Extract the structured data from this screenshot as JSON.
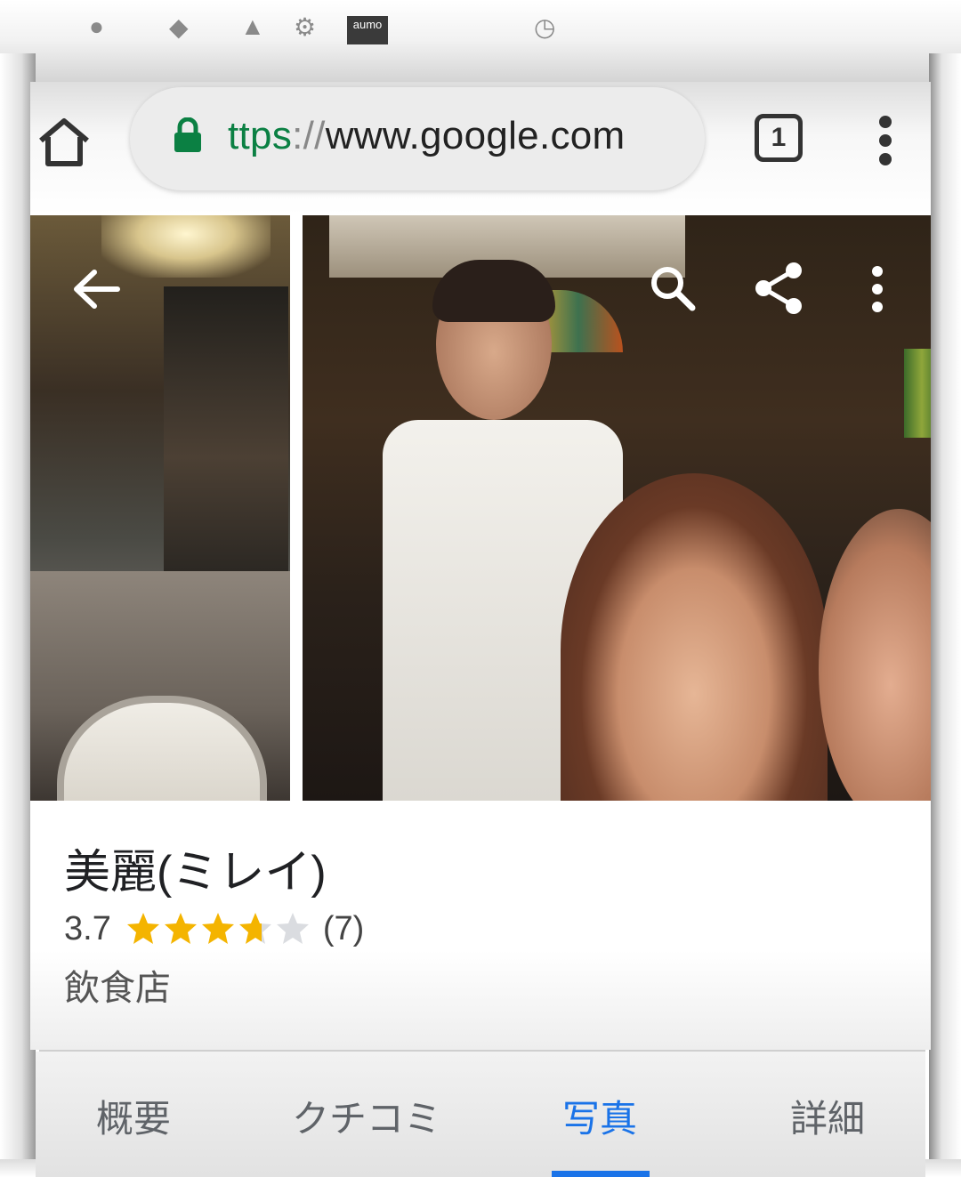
{
  "status_bar": {
    "carrier_badge": "aumo"
  },
  "browser": {
    "url_scheme": "ttps",
    "url_separator": "://",
    "url_host": "www.google.com",
    "tab_count": "1",
    "icons": [
      "home-icon",
      "lock-icon",
      "tab-switcher-icon",
      "more-vert-icon"
    ]
  },
  "photos": {
    "icons": [
      "back-arrow-icon",
      "search-icon",
      "share-icon",
      "more-vert-icon"
    ]
  },
  "place": {
    "name": "美麗(ミレイ)",
    "rating": "3.7",
    "rating_value": 3.7,
    "review_count": "(7)",
    "category": "飲食店"
  },
  "tabs": [
    {
      "label": "概要",
      "active": false
    },
    {
      "label": "クチコミ",
      "active": false
    },
    {
      "label": "写真",
      "active": true
    },
    {
      "label": "詳細",
      "active": false
    }
  ],
  "colors": {
    "accent": "#1a73e8",
    "star": "#f4b400",
    "star_empty": "#dadce0",
    "secure_green": "#0b8043"
  }
}
